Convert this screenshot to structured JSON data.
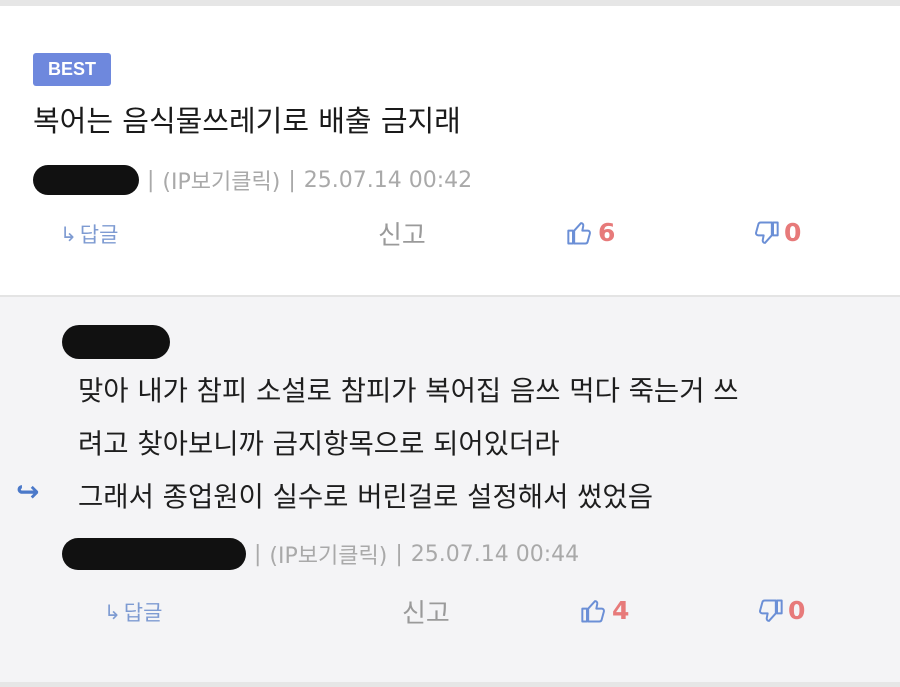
{
  "best_comment": {
    "badge": "BEST",
    "text": "복어는 음식물쓰레기로 배출 금지래",
    "author_suffix": "(IP보기클릭)",
    "separator": "|",
    "timestamp": "25.07.14 00:42",
    "reply_label": "답글",
    "report_label": "신고",
    "likes": "6",
    "dislikes": "0"
  },
  "reply_comment": {
    "lines": [
      "맞아 내가 참피 소설로 참피가 복어집 음쓰 먹다 죽는거 쓰",
      "려고 찾아보니까 금지항목으로 되어있더라",
      "그래서 종업원이 실수로 버린걸로 설정해서 썼었음"
    ],
    "author_suffix": "(IP보기클릭)",
    "separator": "|",
    "timestamp": "25.07.14 00:44",
    "reply_label": "답글",
    "report_label": "신고",
    "likes": "4",
    "dislikes": "0"
  },
  "icons": {
    "reply_arrow": "reply-arrow-icon",
    "thumbs_up": "thumbs-up-icon",
    "thumbs_down": "thumbs-down-icon"
  },
  "colors": {
    "badge": "#6e88dd",
    "vote_count": "#e77a7a",
    "icon_blue": "#6b8fd6",
    "reply_bg": "#f4f4f6"
  }
}
